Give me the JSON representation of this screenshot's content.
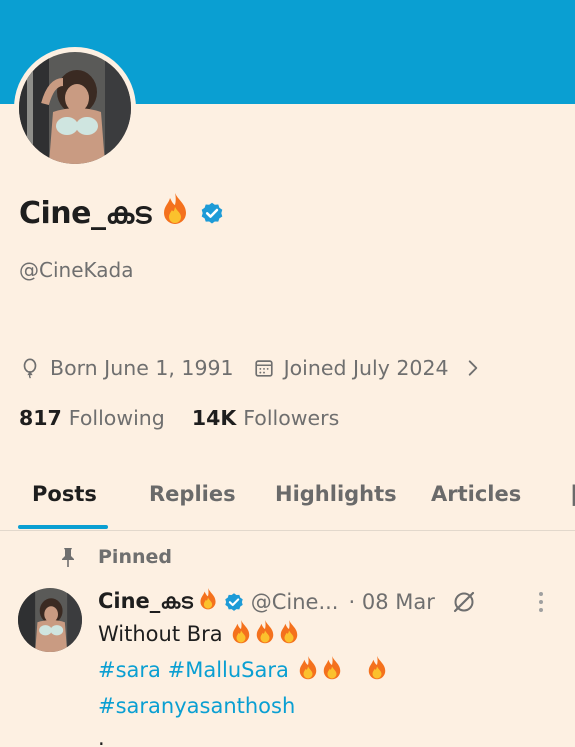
{
  "profile": {
    "display_name": "Cine_കട",
    "display_emoji": "🔥",
    "verified": true,
    "handle": "@CineKada",
    "born": "Born June 1, 1991",
    "joined": "Joined July 2024",
    "following_count": "817",
    "following_label": "Following",
    "followers_count": "14K",
    "followers_label": "Followers"
  },
  "tabs": [
    "Posts",
    "Replies",
    "Highlights",
    "Articles"
  ],
  "active_tab": "Posts",
  "pinned_label": "Pinned",
  "tweet": {
    "name": "Cine_കട",
    "handle": "@Cine...",
    "date": "· 08 Mar",
    "line1": "Without Bra",
    "hashtag_sara": "#sara",
    "hashtag_mallusara": "#MalluSara",
    "hashtag_saranya": "#saranyasanthosh",
    "line4": "."
  },
  "colors": {
    "accent": "#0a9fd2",
    "background": "#fdf0e2",
    "text": "#1e1e1e",
    "muted": "#6f6f6f"
  },
  "icons": [
    "balloon-icon",
    "calendar-icon",
    "chevron-right-icon",
    "pin-icon",
    "grok-icon",
    "more-icon",
    "verified-badge-icon",
    "fire-emoji"
  ]
}
